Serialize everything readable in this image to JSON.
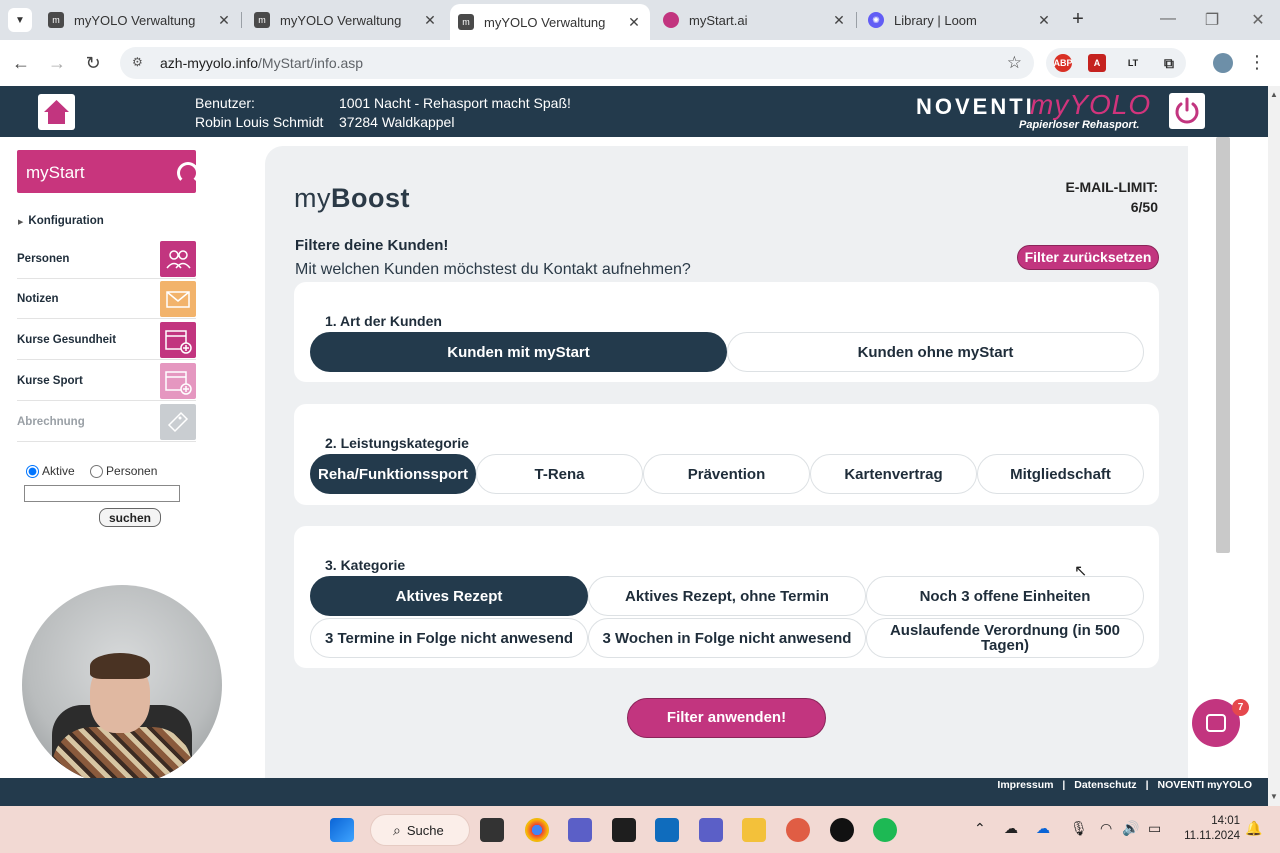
{
  "browser": {
    "tabs": [
      {
        "title": "myYOLO Verwaltung",
        "favicon": "myyolo-favicon",
        "active": false
      },
      {
        "title": "myYOLO Verwaltung",
        "favicon": "myyolo-favicon",
        "active": false
      },
      {
        "title": "myYOLO Verwaltung",
        "favicon": "myyolo-favicon",
        "active": true
      },
      {
        "title": "myStart.ai",
        "favicon": "mystart-favicon",
        "active": false
      },
      {
        "title": "Library | Loom",
        "favicon": "loom-favicon",
        "active": false
      }
    ],
    "url_host": "azh-myyolo.info",
    "url_path": "/MyStart/info.asp"
  },
  "header": {
    "user_label": "Benutzer:",
    "user_name": "Robin Louis Schmidt",
    "org_name": "1001 Nacht - Rehasport macht Spaß!",
    "org_address": "37284 Waldkappel",
    "brand_noventi": "NOVENTI",
    "brand_myyolo": "myYOLO",
    "brand_tagline": "Papierloser Rehasport."
  },
  "sidebar": {
    "mystart_label": "myStart",
    "config_label": "Konfiguration",
    "items": [
      {
        "label": "Personen",
        "icon": "people-icon",
        "color": "#c2357f"
      },
      {
        "label": "Notizen",
        "icon": "envelope-icon",
        "color": "#f2b36b"
      },
      {
        "label": "Kurse Gesundheit",
        "icon": "calendar-plus-icon",
        "color": "#c2357f"
      },
      {
        "label": "Kurse Sport",
        "icon": "calendar-plus-icon",
        "color": "#e597c0"
      },
      {
        "label": "Abrechnung",
        "icon": "ticket-icon",
        "color": "#c9cdd1"
      }
    ],
    "search": {
      "radio_active": "Aktive",
      "radio_persons": "Personen",
      "input_value": "",
      "button": "suchen"
    }
  },
  "main": {
    "logo_my": "my",
    "logo_boost": "Boost",
    "email_limit_label": "E-MAIL-LIMIT:",
    "email_limit_value": "6/50",
    "title": "Filtere deine Kunden!",
    "subtitle": "Mit welchen Kunden möchstest du Kontakt aufnehmen?",
    "reset_button": "Filter zurücksetzen",
    "sections": [
      {
        "title": "1. Art der Kunden",
        "options": [
          "Kunden mit myStart",
          "Kunden ohne myStart"
        ],
        "selected": 0
      },
      {
        "title": "2. Leistungskategorie",
        "options": [
          "Reha/Funktionssport",
          "T-Rena",
          "Prävention",
          "Kartenvertrag",
          "Mitgliedschaft"
        ],
        "selected": 0
      },
      {
        "title": "3. Kategorie",
        "options": [
          "Aktives Rezept",
          "Aktives Rezept, ohne Termin",
          "Noch 3 offene Einheiten",
          "3 Termine in Folge nicht anwesend",
          "3 Wochen in Folge nicht anwesend",
          "Auslaufende Verordnung (in 500 Tagen)"
        ],
        "selected": 0
      }
    ],
    "apply_button": "Filter anwenden!",
    "chat_badge": "7"
  },
  "footer": {
    "links": [
      "Impressum",
      "|",
      "Datenschutz",
      "|",
      "NOVENTI myYOLO"
    ]
  },
  "taskbar": {
    "search_label": "Suche",
    "time": "14:01",
    "date": "11.11.2024"
  },
  "colors": {
    "primary_dark": "#233a4c",
    "accent_pink": "#c2357f",
    "panel_bg": "#eef0f2"
  }
}
